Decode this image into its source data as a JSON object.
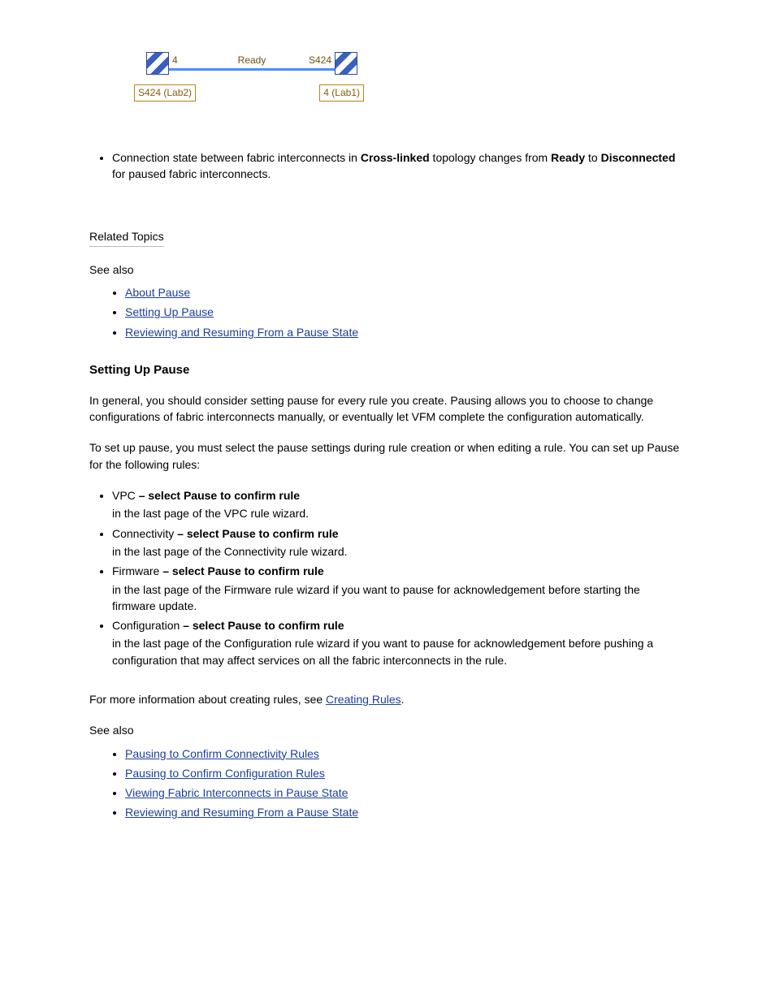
{
  "diagram": {
    "left_port": "4",
    "status": "Ready",
    "right_port": "S424",
    "left_name": "S424 (Lab2)",
    "right_name": "4 (Lab1)"
  },
  "bullet_top": {
    "text_before": "Connection state between fabric interconnects in ",
    "strong": "Cross-linked",
    "text_after_1": " topology changes from ",
    "strong2": "Ready",
    "text_after_2": " to ",
    "strong3": "Disconnected",
    "text_after_3": " for paused fabric interconnects."
  },
  "section1": {
    "heading": "Related Topics",
    "intro": "See also",
    "links": [
      "About Pause",
      "Setting Up Pause",
      "Reviewing and Resuming From a Pause State"
    ]
  },
  "section2": {
    "title": "Setting Up Pause",
    "p1": "In general, you should consider setting pause for every rule you create. Pausing allows you to choose to change configurations of fabric interconnects manually, or eventually let VFM complete the configuration automatically.",
    "p2": "To set up pause, you must select the pause settings during rule creation or when editing a rule. You can set up Pause for the following rules:",
    "bullets": [
      {
        "before": "VPC ",
        "strong": "– select Pause to confirm rule",
        "after": "in the last page of the VPC rule wizard."
      },
      {
        "before": "Connectivity",
        "strong": " – select Pause to confirm rule",
        "after": "in the last page of the Connectivity rule wizard."
      },
      {
        "before": "Firmware",
        "strong": " – select Pause to confirm rule",
        "after": "in the last page of the Firmware rule wizard if you want to pause for acknowledgement before starting the firmware update."
      },
      {
        "before": "Configuration",
        "strong": " – select Pause to confirm rule",
        "after": "in the last page of the Configuration rule wizard if you want to pause for acknowledgement before pushing a configuration that may affect services on all the fabric interconnects in the rule."
      }
    ],
    "p3_before": "For more information about creating rules, see ",
    "p3_link": "Creating Rules",
    "p3_after": ".",
    "intro2": "See also",
    "links2": [
      "Pausing to Confirm Connectivity Rules",
      "Pausing to Confirm Configuration Rules",
      "Viewing Fabric Interconnects in Pause State",
      "Reviewing and Resuming From a Pause State"
    ]
  }
}
